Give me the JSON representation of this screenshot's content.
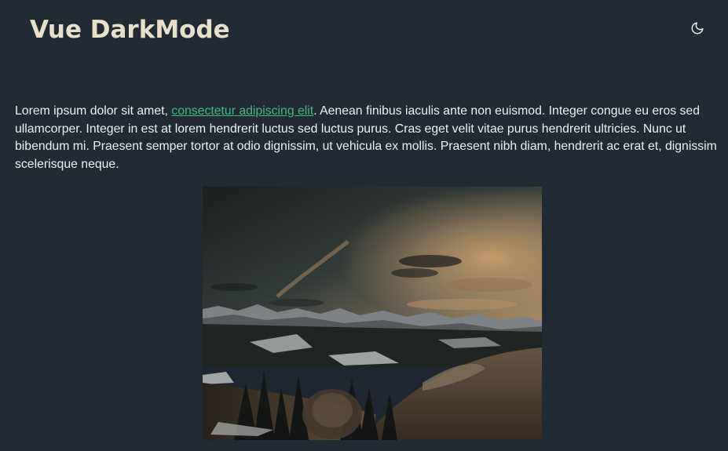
{
  "header": {
    "title": "Vue DarkMode",
    "theme_toggle_icon": "moon-icon"
  },
  "article": {
    "text_before_link": "Lorem ipsum dolor sit amet, ",
    "link_text": "consectetur adipiscing elit",
    "text_after_link": ". Aenean finibus iaculis ante non euismod. Integer congue eu eros sed ullamcorper. Integer in est at lorem hendrerit luctus sed luctus purus. Cras eget velit vitae purus hendrerit ultricies. Nunc ut bibendum mi. Praesent semper tortor at odio dignissim, ut vehicula ex mollis. Praesent nibh diam, hendrerit ac erat et, dignissim scelerisque neque."
  },
  "image": {
    "subject": "landscape-photo"
  },
  "colors": {
    "background": "#222a33",
    "title": "#e7e0cc",
    "text": "#eef0f2",
    "link": "#41b883"
  }
}
